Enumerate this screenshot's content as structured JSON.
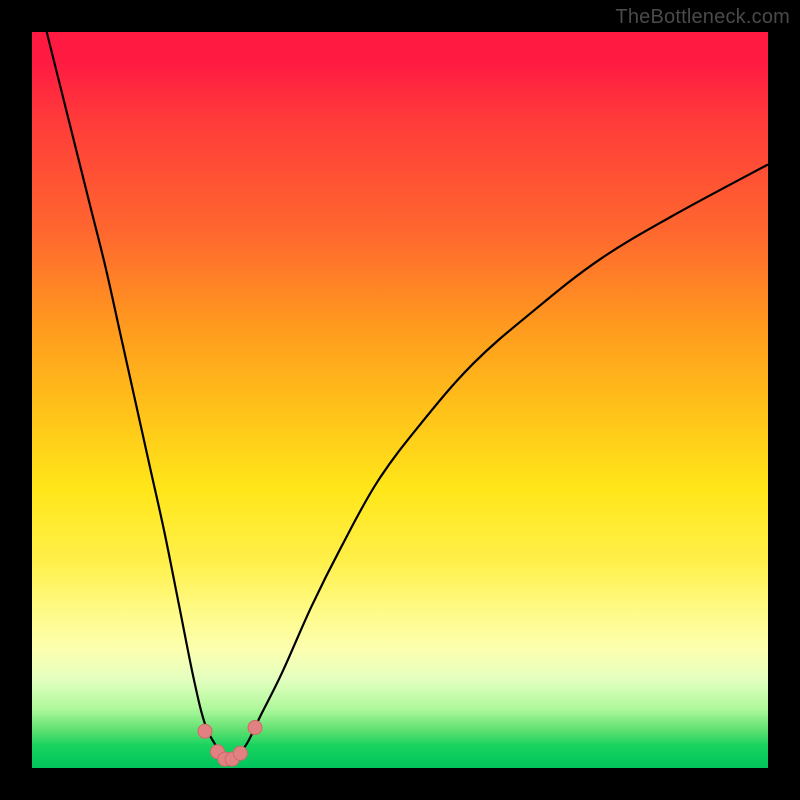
{
  "attribution": "TheBottleneck.com",
  "colors": {
    "page_bg": "#000000",
    "curve_stroke": "#000000",
    "marker_fill": "#e28181",
    "marker_stroke": "#d06a6a"
  },
  "chart_data": {
    "type": "line",
    "title": "",
    "xlabel": "",
    "ylabel": "",
    "xlim": [
      0,
      100
    ],
    "ylim": [
      0,
      100
    ],
    "grid": false,
    "legend": false,
    "note": "Axes have no tick labels; values below are approximate percentages of the plot area (0=left/bottom, 100=right/top), estimated from curve geometry.",
    "series": [
      {
        "name": "left-branch",
        "x": [
          2,
          4,
          6,
          8,
          10,
          12,
          14,
          16,
          18,
          20,
          22,
          23.5,
          25,
          26,
          27
        ],
        "values": [
          100,
          92,
          84,
          76,
          68,
          59,
          50,
          41,
          32,
          22,
          12,
          6,
          3,
          1.5,
          1
        ]
      },
      {
        "name": "right-branch",
        "x": [
          27,
          29,
          31,
          34,
          38,
          42,
          47,
          53,
          60,
          68,
          77,
          87,
          100
        ],
        "values": [
          1,
          3,
          7,
          13,
          22,
          30,
          39,
          47,
          55,
          62,
          69,
          75,
          82
        ]
      }
    ],
    "markers": {
      "name": "trough-dots",
      "x": [
        23.5,
        25.2,
        26.2,
        27.2,
        28.3,
        30.3
      ],
      "values": [
        5,
        2.2,
        1.2,
        1.2,
        2.0,
        5.5
      ]
    }
  }
}
